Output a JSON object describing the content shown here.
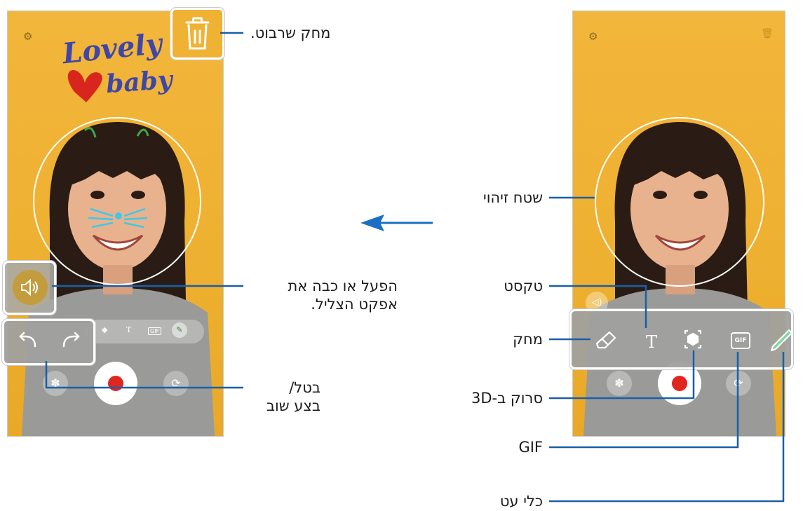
{
  "labels": {
    "clear_drawing": "מחק שרבוט.",
    "sound_toggle_line1": "הפעל או כבה את",
    "sound_toggle_line2": "אפקט הצליל.",
    "undo_redo_line1": "בטל/",
    "undo_redo_line2": "בצע שוב",
    "detection_area": "שטח זיהוי",
    "text": "טקסט",
    "eraser": "מחק",
    "scan_3d": "סרוק ב-3D",
    "gif": "GIF",
    "pen_tool": "כלי עט"
  },
  "left_phone": {
    "drawing_text_line1": "Lovely",
    "drawing_text_line2": "baby",
    "gif_badge": "GIF",
    "text_icon": "T"
  },
  "right_phone": {
    "gif_badge": "GIF",
    "text_icon": "T"
  },
  "colors": {
    "background_yellow": "#f0b234",
    "callout_line": "#1a5fa8",
    "arrow_blue": "#1a6fc4",
    "record_red": "#e0261f",
    "drawing_blue": "#3e46a8",
    "heart_red": "#d8261e",
    "ear_green": "#3aa846",
    "whisker_cyan": "#3ec8e8"
  },
  "icons": [
    "settings-gear-icon",
    "trash-icon",
    "speaker-icon",
    "undo-icon",
    "redo-icon",
    "eraser-icon",
    "text-icon",
    "scan-3d-icon",
    "gif-icon",
    "pen-icon",
    "effects-icon",
    "record-button",
    "switch-camera-icon",
    "direction-arrow-icon"
  ]
}
